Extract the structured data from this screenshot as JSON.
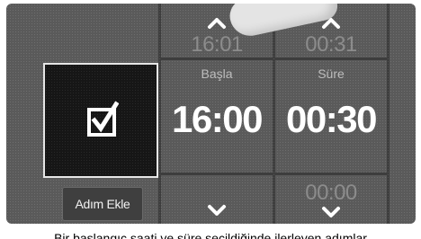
{
  "start_column": {
    "label": "Başla",
    "preview_time": "16:01",
    "value": "16:00"
  },
  "duration_column": {
    "label": "Süre",
    "preview_time": "00:31",
    "value": "00:30",
    "below_time": "00:00"
  },
  "buttons": {
    "add_step_label": "Adım Ekle"
  },
  "icons": {
    "confirm": "checkbox-checked-icon",
    "increase": "chevron-up-icon",
    "decrease": "chevron-down-icon"
  },
  "caption": "Bir başlangıç saati ve süre seçildiğinde ilerleyen adımlar"
}
